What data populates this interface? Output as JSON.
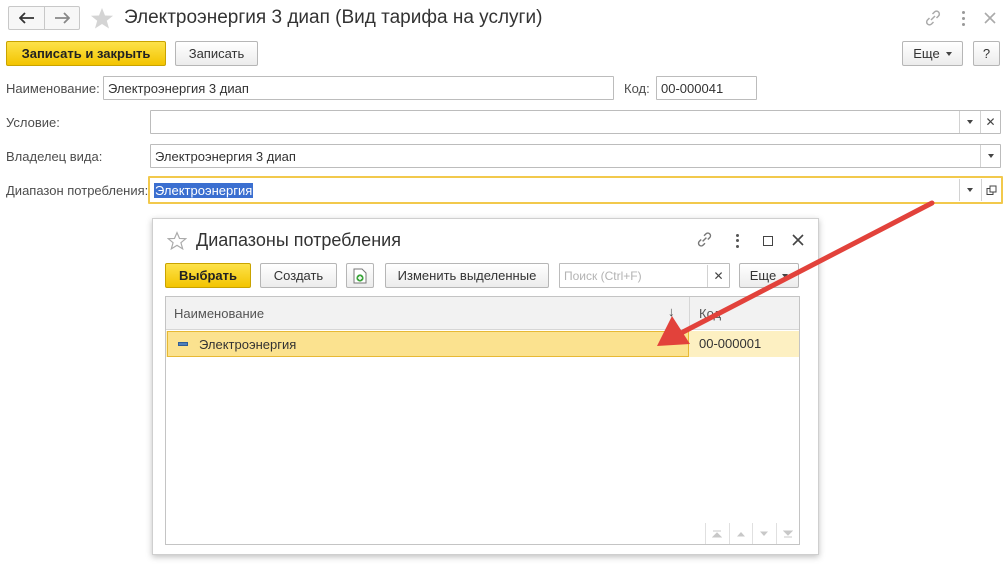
{
  "window": {
    "title": "Электроэнергия 3 диап (Вид тарифа на услуги)"
  },
  "toolbar": {
    "write_close_label": "Записать и закрыть",
    "write_label": "Записать",
    "more_label": "Еще",
    "help_label": "?"
  },
  "form": {
    "name_label": "Наименование:",
    "name_value": "Электроэнергия 3 диап",
    "code_label": "Код:",
    "code_value": "00-000041",
    "condition_label": "Условие:",
    "condition_value": "",
    "owner_label": "Владелец вида:",
    "owner_value": "Электроэнергия 3 диап",
    "range_label": "Диапазон потребления:",
    "range_value": "Электроэнергия"
  },
  "dialog": {
    "title": "Диапазоны потребления",
    "select_label": "Выбрать",
    "create_label": "Создать",
    "change_selected_label": "Изменить выделенные",
    "search_placeholder": "Поиск (Ctrl+F)",
    "more_label": "Еще",
    "columns": {
      "name": "Наименование",
      "code": "Код"
    },
    "rows": [
      {
        "name": "Электроэнергия",
        "code": "00-000001"
      }
    ]
  },
  "colors": {
    "accent_yellow": "#f3c400",
    "selection_row": "#fbe28f",
    "arrow": "#e2423b"
  }
}
